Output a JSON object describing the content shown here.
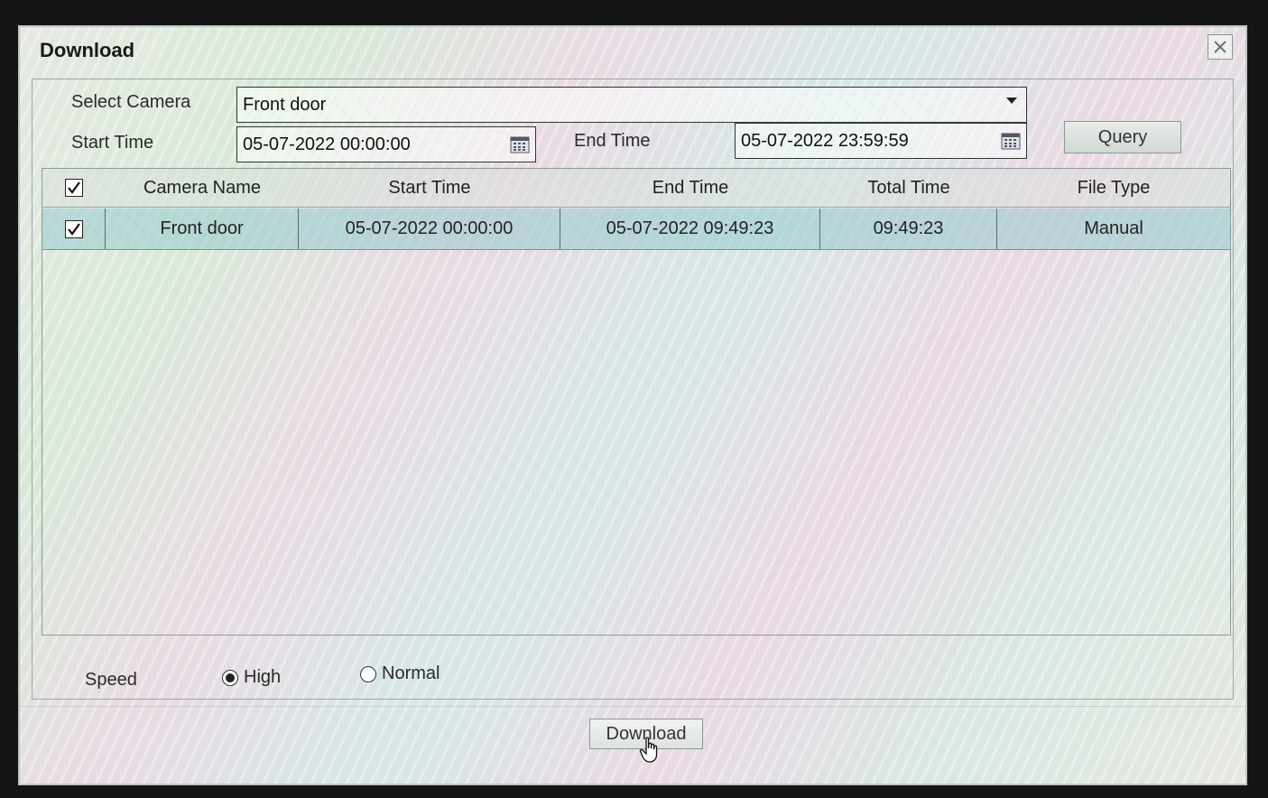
{
  "dialog": {
    "title": "Download"
  },
  "filters": {
    "select_camera_label": "Select Camera",
    "camera_value": "Front door",
    "start_time_label": "Start Time",
    "start_time_value": "05-07-2022 00:00:00",
    "end_time_label": "End Time",
    "end_time_value": "05-07-2022 23:59:59",
    "query_label": "Query"
  },
  "table": {
    "columns": [
      "Camera Name",
      "Start Time",
      "End Time",
      "Total Time",
      "File Type"
    ],
    "rows": [
      {
        "checked": true,
        "camera_name": "Front door",
        "start_time": "05-07-2022 00:00:00",
        "end_time": "05-07-2022 09:49:23",
        "total_time": "09:49:23",
        "file_type": "Manual"
      }
    ],
    "select_all_checked": true
  },
  "speed": {
    "label": "Speed",
    "options": [
      "High",
      "Normal"
    ],
    "selected": "High"
  },
  "actions": {
    "download_label": "Download"
  },
  "icons": [
    "close-icon",
    "dropdown-arrow-icon",
    "calendar-icon",
    "checkbox-checked-icon",
    "hand-cursor-icon"
  ]
}
